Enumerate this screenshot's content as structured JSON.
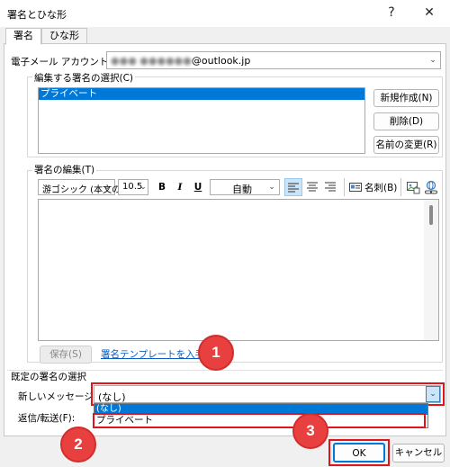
{
  "window": {
    "title": "署名とひな形",
    "help_btn": "?",
    "close_btn": "✕"
  },
  "tabs": [
    {
      "label": "署名"
    },
    {
      "label": "ひな形"
    }
  ],
  "account": {
    "label": "電子メール アカウント(A):",
    "value_hidden": "●●● ●●●●●●",
    "value_domain": "@outlook.jp"
  },
  "select_group": {
    "label": "編集する署名の選択(C)",
    "items": [
      "プライベート"
    ]
  },
  "side_buttons": {
    "new": "新規作成(N)",
    "delete": "削除(D)",
    "rename": "名前の変更(R)"
  },
  "edit_group": {
    "label": "署名の編集(T)"
  },
  "toolbar": {
    "font": "游ゴシック (本文の",
    "size": "10.5",
    "bold": "B",
    "italic": "I",
    "underline": "U",
    "color": "自動",
    "business_card": "名刺(B)"
  },
  "bottom": {
    "save": "保存(S)",
    "template_link": "署名テンプレートを入手する"
  },
  "default_group": {
    "label": "既定の署名の選択",
    "new_message_label": "新しいメッセージ(M):",
    "new_message_value": "(なし)",
    "reply_label": "返信/転送(F):",
    "dropdown_options": [
      "(なし)",
      "プライベート"
    ]
  },
  "footer": {
    "ok": "OK",
    "cancel": "キャンセル"
  },
  "callouts": [
    "1",
    "2",
    "3"
  ],
  "colors": {
    "accent": "#0078d7",
    "callout_red": "#e8403f",
    "highlight_red": "#e0151b",
    "link": "#0b5cbe"
  }
}
